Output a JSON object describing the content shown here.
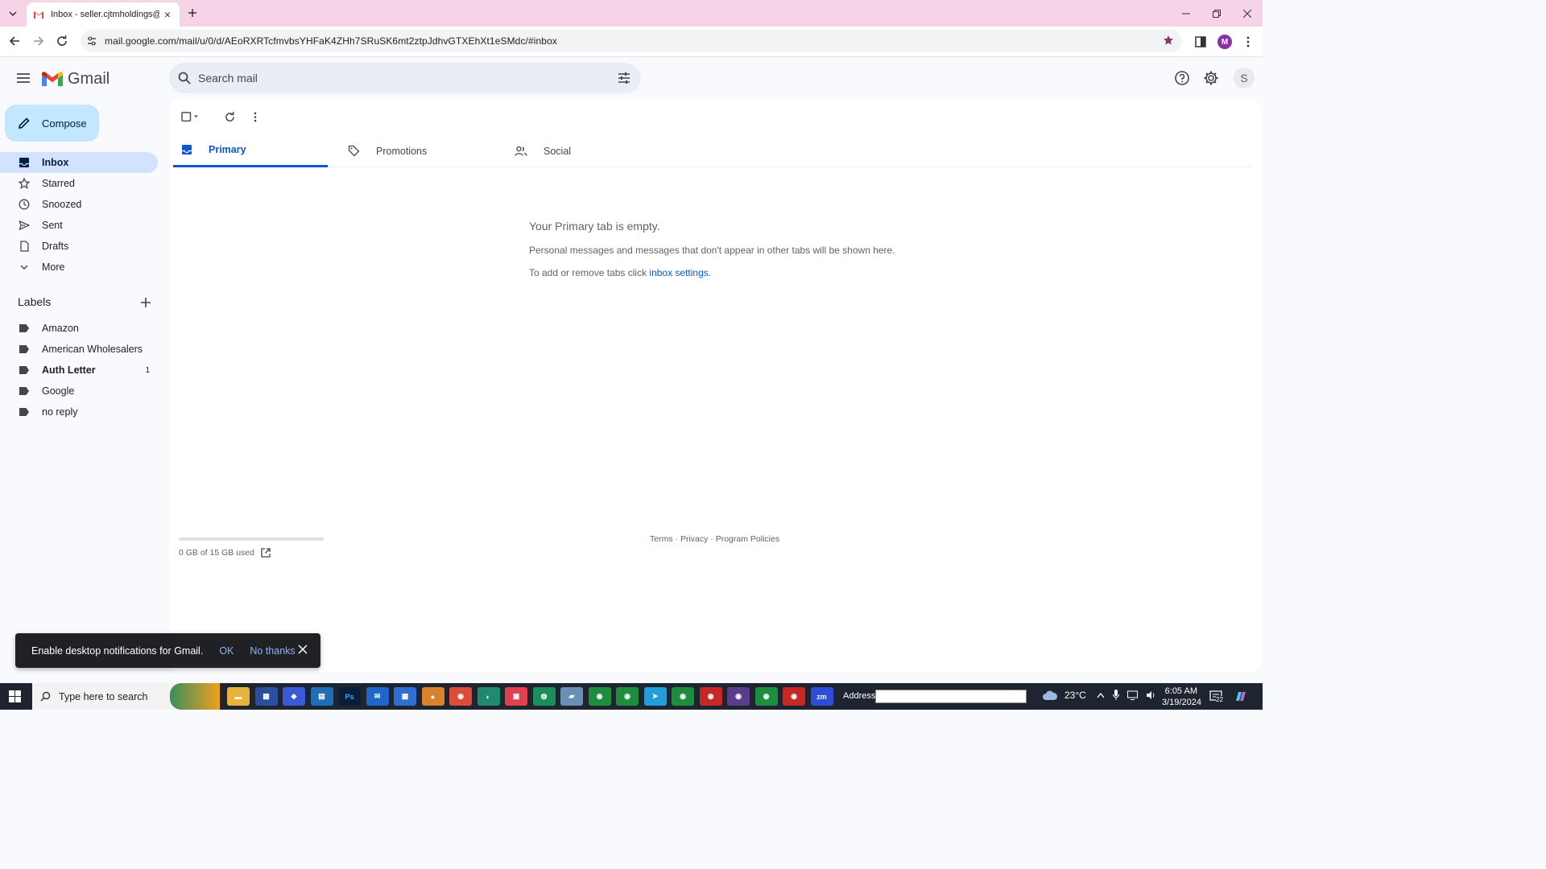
{
  "browser": {
    "tab_title": "Inbox - seller.cjtmholdings@gm",
    "url": "mail.google.com/mail/u/0/d/AEoRXRTcfmvbsYHFaK4ZHh7SRuSK6mt2ztpJdhvGTXEhXt1eSMdc/#inbox",
    "profile_initial": "M"
  },
  "header": {
    "app_name": "Gmail",
    "search_placeholder": "Search mail",
    "account_initial": "S"
  },
  "sidebar": {
    "compose_label": "Compose",
    "items": [
      {
        "label": "Inbox",
        "icon": "inbox-icon"
      },
      {
        "label": "Starred",
        "icon": "star-icon"
      },
      {
        "label": "Snoozed",
        "icon": "clock-icon"
      },
      {
        "label": "Sent",
        "icon": "send-icon"
      },
      {
        "label": "Drafts",
        "icon": "draft-icon"
      },
      {
        "label": "More",
        "icon": "chevron-down-icon"
      }
    ],
    "labels_title": "Labels",
    "labels": [
      {
        "label": "Amazon",
        "count": ""
      },
      {
        "label": "American Wholesalers",
        "count": ""
      },
      {
        "label": "Auth Letter",
        "count": "1"
      },
      {
        "label": "Google",
        "count": ""
      },
      {
        "label": "no reply",
        "count": ""
      }
    ]
  },
  "main": {
    "tabs": [
      {
        "label": "Primary"
      },
      {
        "label": "Promotions"
      },
      {
        "label": "Social"
      }
    ],
    "empty_title": "Your Primary tab is empty.",
    "empty_message": "Personal messages and messages that don't appear in other tabs will be shown here.",
    "settings_prefix": "To add or remove tabs click ",
    "settings_link": "inbox settings",
    "settings_suffix": ".",
    "storage_text": "0 GB of 15 GB used",
    "storage_fraction": 0,
    "footer_terms": "Terms",
    "footer_privacy": "Privacy",
    "footer_policies": "Program Policies",
    "footer_sep": " · "
  },
  "snackbar": {
    "message": "Enable desktop notifications for Gmail.",
    "ok": "OK",
    "no_thanks": "No thanks"
  },
  "taskbar": {
    "search_placeholder": "Type here to search",
    "address_label": "Address",
    "temperature": "23°C",
    "time": "6:05 AM",
    "date": "3/19/2024",
    "notification_count": "22"
  },
  "colors": {
    "accent": "#0b57d0",
    "compose_bg": "#c2e7ff",
    "active_nav_bg": "#d3e3fd",
    "tabstrip": "#f6d3e6"
  }
}
